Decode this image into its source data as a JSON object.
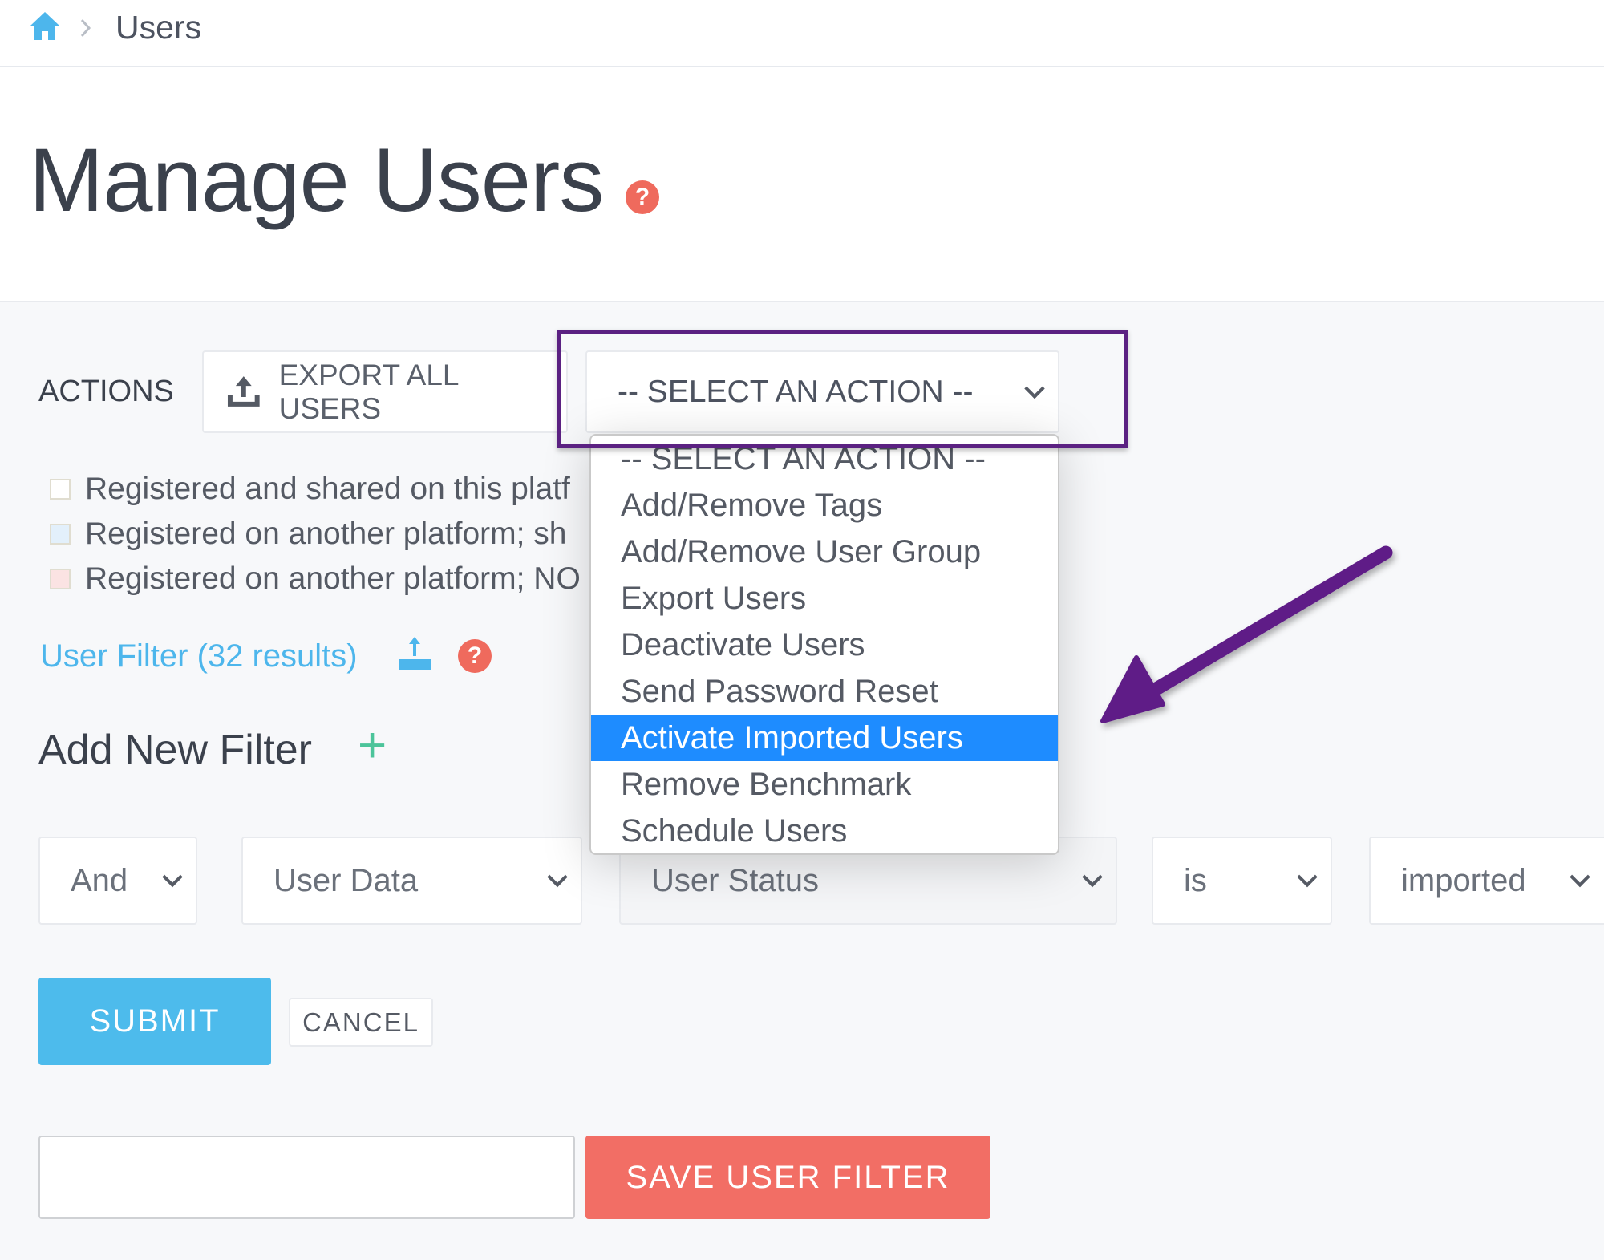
{
  "breadcrumb": {
    "home_icon": "home-icon",
    "separator_icon": "chevron-right-icon",
    "current": "Users"
  },
  "page": {
    "title": "Manage Users",
    "help_icon": "question-circle-icon"
  },
  "actions": {
    "label": "ACTIONS",
    "export_all_label": "EXPORT ALL USERS",
    "export_icon": "upload-icon",
    "select_value": "-- SELECT AN ACTION --",
    "options": [
      "-- SELECT AN ACTION --",
      "Add/Remove Tags",
      "Add/Remove User Group",
      "Export Users",
      "Deactivate Users",
      "Send Password Reset",
      "Activate Imported Users",
      "Remove Benchmark",
      "Schedule Users"
    ],
    "highlighted_option": "Activate Imported Users"
  },
  "legend": [
    {
      "text": "Registered and shared on this platf",
      "color": "#ffffff"
    },
    {
      "text": "Registered on another platform; sh",
      "color": "#e3f0fb"
    },
    {
      "text": "Registered on another platform; NO",
      "color": "#fbe3e3"
    }
  ],
  "filter": {
    "link": "User Filter (32 results)",
    "export_icon": "upload-icon",
    "help_icon": "question-circle-icon",
    "add_new": "Add New Filter",
    "add_icon": "plus-icon",
    "fields": [
      "And",
      "User Data",
      "User Status",
      "is",
      "imported"
    ],
    "submit": "SUBMIT",
    "cancel": "CANCEL",
    "name_value": "",
    "save": "SAVE USER FILTER"
  },
  "annotation": {
    "color": "#5b2182"
  },
  "colors": {
    "accent": "#4dbbec",
    "danger": "#f26e65",
    "selected": "#1e8cff"
  }
}
